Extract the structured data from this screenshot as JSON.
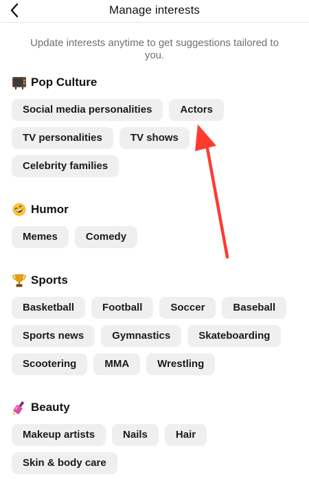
{
  "header": {
    "title": "Manage interests"
  },
  "subtitle": "Update interests anytime to get suggestions tailored to you.",
  "sections": [
    {
      "title": "Pop Culture",
      "icon": "tv-icon",
      "chips": [
        "Social media personalities",
        "Actors",
        "TV personalities",
        "TV shows",
        "Celebrity families"
      ]
    },
    {
      "title": "Humor",
      "icon": "rofl-face-icon",
      "chips": [
        "Memes",
        "Comedy"
      ]
    },
    {
      "title": "Sports",
      "icon": "trophy-icon",
      "chips": [
        "Basketball",
        "Football",
        "Soccer",
        "Baseball",
        "Sports news",
        "Gymnastics",
        "Skateboarding",
        "Scootering",
        "MMA",
        "Wrestling"
      ]
    },
    {
      "title": "Beauty",
      "icon": "nail-polish-icon",
      "chips": [
        "Makeup artists",
        "Nails",
        "Hair",
        "Skin & body care"
      ]
    }
  ],
  "annotation": {
    "color": "#ff3b30"
  }
}
